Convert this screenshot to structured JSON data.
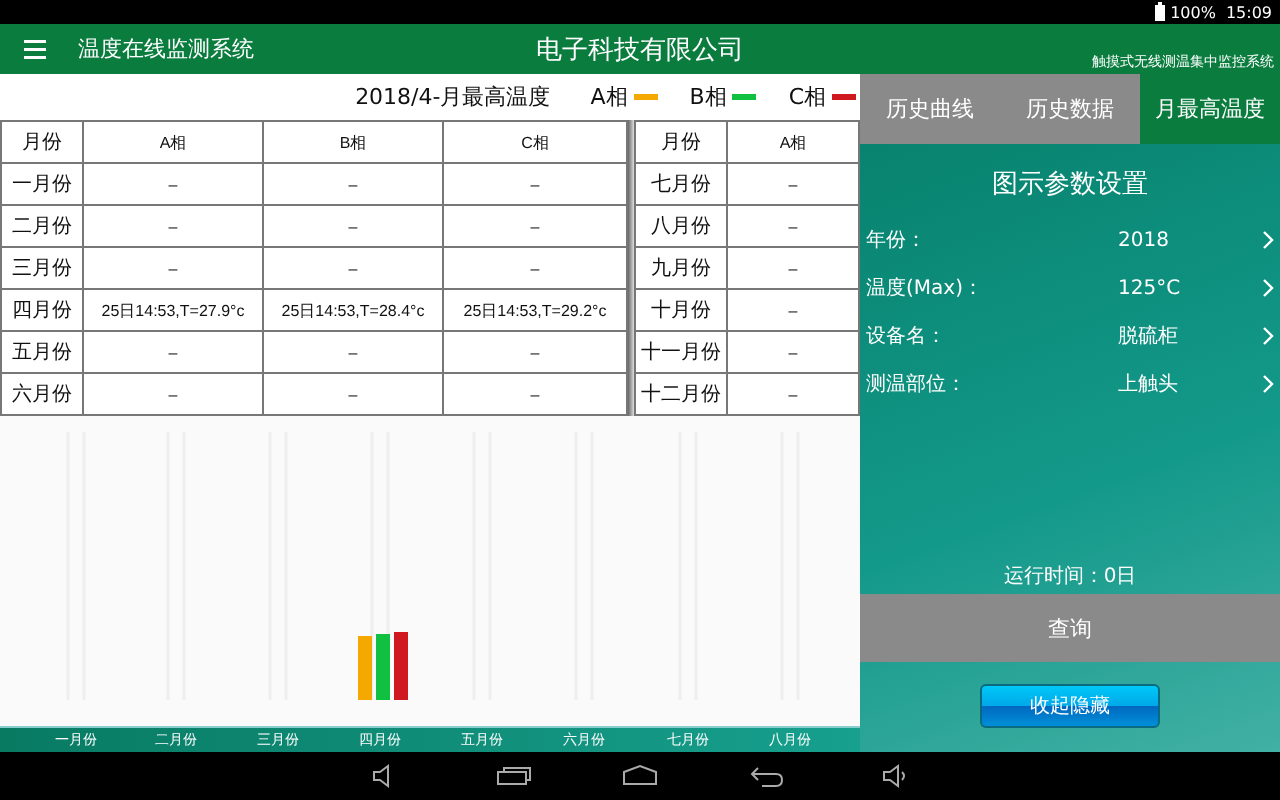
{
  "status_bar": {
    "battery": "100%",
    "time": "15:09"
  },
  "header": {
    "title": "温度在线监测系统",
    "company": "电子科技有限公司",
    "subtitle": "触摸式无线测温集中监控系统"
  },
  "legend": {
    "title": "2018/4-月最高温度",
    "items": [
      {
        "label": "A相",
        "color": "#f5a800"
      },
      {
        "label": "B相",
        "color": "#10c040"
      },
      {
        "label": "C相",
        "color": "#d01820"
      }
    ]
  },
  "table": {
    "columns": [
      "月份",
      "A相",
      "B相",
      "C相"
    ],
    "rows": [
      [
        "一月份",
        "–",
        "–",
        "–"
      ],
      [
        "二月份",
        "–",
        "–",
        "–"
      ],
      [
        "三月份",
        "–",
        "–",
        "–"
      ],
      [
        "四月份",
        "25日14:53,T=27.9°c",
        "25日14:53,T=28.4°c",
        "25日14:53,T=29.2°c"
      ],
      [
        "五月份",
        "–",
        "–",
        "–"
      ],
      [
        "六月份",
        "–",
        "–",
        "–"
      ]
    ]
  },
  "table_right": {
    "columns": [
      "月份",
      "A相"
    ],
    "rows": [
      [
        "七月份",
        "–"
      ],
      [
        "八月份",
        "–"
      ],
      [
        "九月份",
        "–"
      ],
      [
        "十月份",
        "–"
      ],
      [
        "十一月份",
        "–"
      ],
      [
        "十二月份",
        "–"
      ]
    ]
  },
  "chart": {
    "x_labels": [
      "一月份",
      "二月份",
      "三月份",
      "四月份",
      "五月份",
      "六月份",
      "七月份",
      "八月份"
    ]
  },
  "tabs": [
    {
      "label": "历史曲线",
      "selected": false
    },
    {
      "label": "历史数据",
      "selected": false
    },
    {
      "label": "月最高温度",
      "selected": true
    }
  ],
  "settings": {
    "title": "图示参数设置",
    "rows": [
      {
        "label": "年份：",
        "value": "2018"
      },
      {
        "label": "温度(Max)：",
        "value": "125°C"
      },
      {
        "label": "设备名：",
        "value": "脱硫柜"
      },
      {
        "label": "测温部位：",
        "value": "上触头"
      }
    ]
  },
  "runtime": "运行时间：0日",
  "query_button": "查询",
  "hide_button": "收起隐藏"
}
